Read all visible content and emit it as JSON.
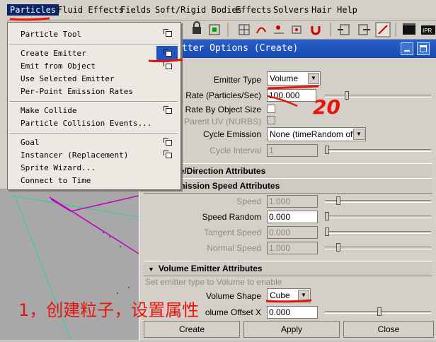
{
  "menu": [
    "Particles",
    "Fluid Effects",
    "Fields",
    "Soft/Rigid Bodies",
    "Effects",
    "Solvers",
    "Hair",
    "Help"
  ],
  "dropdown": {
    "items": [
      {
        "label": "Particle Tool",
        "has_option": true
      },
      {
        "label": "Create Emitter",
        "has_option": true
      },
      {
        "label": "Emit from Object",
        "has_option": true
      },
      {
        "label": "Use Selected Emitter",
        "has_option": false
      },
      {
        "label": "Per-Point Emission Rates",
        "has_option": false
      },
      {
        "label": "Make Collide",
        "has_option": true
      },
      {
        "label": "Particle Collision Events...",
        "has_option": false
      },
      {
        "label": "Goal",
        "has_option": true
      },
      {
        "label": "Instancer (Replacement)",
        "has_option": true
      },
      {
        "label": "Sprite Wizard...",
        "has_option": false
      },
      {
        "label": "Connect to Time",
        "has_option": false
      }
    ]
  },
  "options_window": {
    "title": "tter Options (Create)",
    "emitter_type_label": "Emitter Type",
    "emitter_type_value": "Volume",
    "rate_label": "Rate (Particles/Sec)",
    "rate_value": "100.000",
    "scale_rate_label": "ale Rate By Object Size",
    "need_parent_uv_label": "ed Parent UV (NURBS)",
    "cycle_emission_label": "Cycle Emission",
    "cycle_emission_value": "None (timeRandom off)",
    "cycle_interval_label": "Cycle Interval",
    "cycle_interval_value": "1",
    "section_distance": "ance/Direction Attributes",
    "section_speed": "c Emission Speed Attributes",
    "speed_label": "Speed",
    "speed_value": "1.000",
    "speed_random_label": "Speed Random",
    "speed_random_value": "0.000",
    "tangent_speed_label": "Tangent Speed",
    "tangent_speed_value": "0.000",
    "normal_speed_label": "Normal Speed",
    "normal_speed_value": "1.000",
    "section_volume": "Volume Emitter Attributes",
    "volume_hint": "Set emitter type to Volume to enable",
    "volume_shape_label": "Volume Shape",
    "volume_shape_value": "Cube",
    "volume_offset_label": "olume Offset X",
    "volume_offset_value": "0.000",
    "buttons": {
      "create": "Create",
      "apply": "Apply",
      "close": "Close"
    }
  },
  "annotations": {
    "rate_note": "20",
    "caption": "1，创建粒子，设置属性"
  },
  "colors": {
    "annotation_red": "#e8140c",
    "menu_highlight": "#0a246a",
    "title_blue": "#1f55c0"
  }
}
